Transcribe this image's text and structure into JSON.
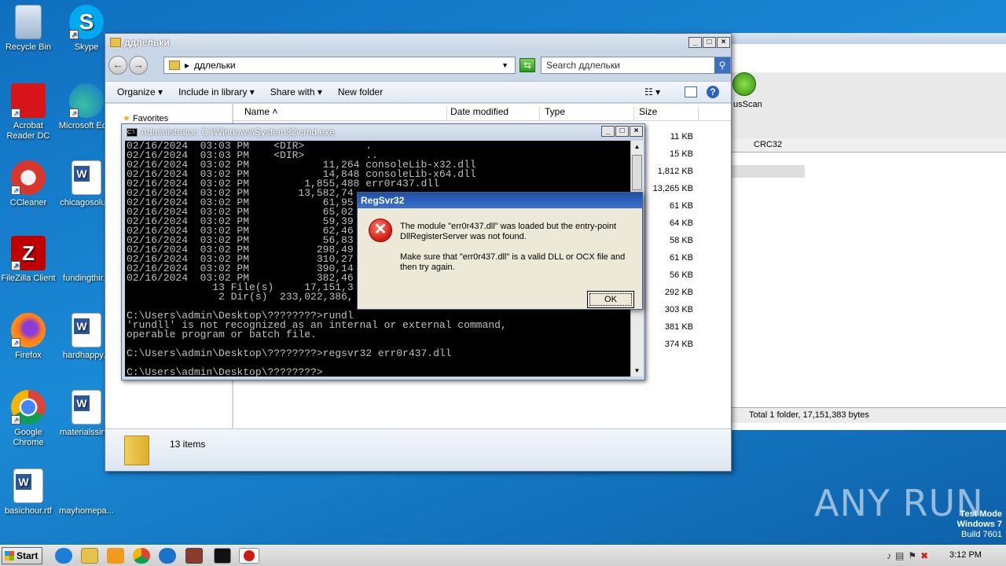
{
  "desktop": {
    "icons": [
      {
        "label": "Recycle Bin"
      },
      {
        "label": "Skype"
      },
      {
        "label": "Acrobat Reader DC"
      },
      {
        "label": "Microsoft Ed..."
      },
      {
        "label": "CCleaner"
      },
      {
        "label": "chicagosolu..."
      },
      {
        "label": "FileZilla Client"
      },
      {
        "label": "fundingthir..."
      },
      {
        "label": "Firefox"
      },
      {
        "label": "hardhappy..."
      },
      {
        "label": "Google Chrome"
      },
      {
        "label": "materialssin..."
      },
      {
        "label": "basichour.rtf"
      },
      {
        "label": "mayhomepa..."
      }
    ]
  },
  "background_window": {
    "tool_label": "usScan",
    "column_header": "CRC32",
    "status": "Total 1 folder, 17,151,383 bytes"
  },
  "explorer": {
    "title": "ддлельки",
    "address": "ддлельки",
    "search_placeholder": "Search ддлельки",
    "commands": {
      "organize": "Organize",
      "include": "Include in library",
      "share": "Share with",
      "new_folder": "New folder"
    },
    "nav_favorites": "Favorites",
    "columns": {
      "name": "Name",
      "date": "Date modified",
      "type": "Type",
      "size": "Size"
    },
    "sizes": [
      "11 KB",
      "15 KB",
      "1,812 KB",
      "13,265 KB",
      "61 KB",
      "64 KB",
      "58 KB",
      "61 KB",
      "56 KB",
      "292 KB",
      "303 KB",
      "381 KB",
      "374 KB"
    ],
    "item_count": "13 items"
  },
  "cmd": {
    "title": "Administrator: C:\\Windows\\System32\\cmd.exe",
    "lines": [
      "02/16/2024  03:03 PM    <DIR>          .",
      "02/16/2024  03:03 PM    <DIR>          ..",
      "02/16/2024  03:02 PM            11,264 consoleLib-x32.dll",
      "02/16/2024  03:02 PM            14,848 consoleLib-x64.dll",
      "02/16/2024  03:02 PM         1,855,488 err0r437.dll",
      "02/16/2024  03:02 PM        13,582,74",
      "02/16/2024  03:02 PM            61,95",
      "02/16/2024  03:02 PM            65,02",
      "02/16/2024  03:02 PM            59,39",
      "02/16/2024  03:02 PM            62,46",
      "02/16/2024  03:02 PM            56,83",
      "02/16/2024  03:02 PM           298,49",
      "02/16/2024  03:02 PM           310,27",
      "02/16/2024  03:02 PM           390,14",
      "02/16/2024  03:02 PM           382,46",
      "              13 File(s)     17,151,3",
      "               2 Dir(s)  233,022,386,",
      "",
      "C:\\Users\\admin\\Desktop\\????????>rundl",
      "'rundll' is not recognized as an internal or external command,",
      "operable program or batch file.",
      "",
      "C:\\Users\\admin\\Desktop\\????????>regsvr32 err0r437.dll",
      "",
      "C:\\Users\\admin\\Desktop\\????????>"
    ]
  },
  "dialog": {
    "title": "RegSvr32",
    "message1": "The module \"err0r437.dll\" was loaded but the entry-point DllRegisterServer was not found.",
    "message2": "Make sure that \"err0r437.dll\" is a valid DLL or OCX file and then try again.",
    "ok": "OK"
  },
  "taskbar": {
    "start": "Start",
    "time": "3:12 PM"
  },
  "watermark": {
    "text": "ANY RUN",
    "test_mode": "Test Mode",
    "os": "Windows 7",
    "build": "Build 7601"
  }
}
